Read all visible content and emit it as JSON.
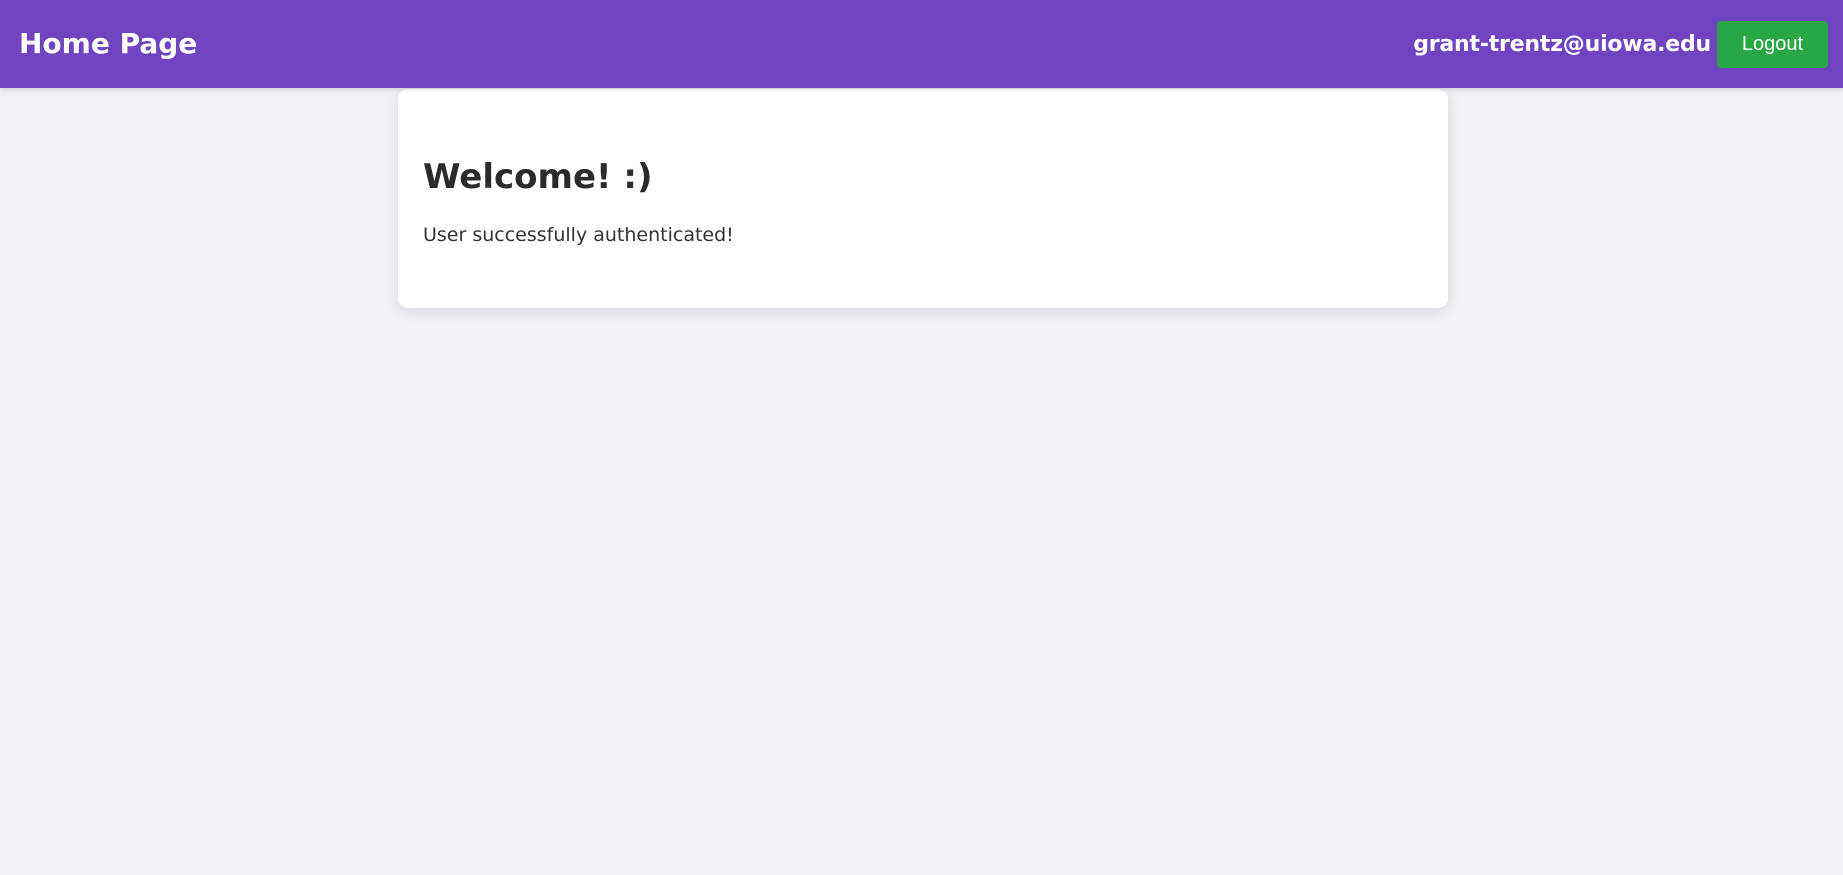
{
  "header": {
    "title": "Home Page",
    "user_email": "grant-trentz@uiowa.edu",
    "logout_label": "Logout"
  },
  "main": {
    "heading": "Welcome! :)",
    "message": "User successfully authenticated!"
  },
  "colors": {
    "header_background": "#7044c1",
    "logout_button": "#28a745",
    "page_background": "#eff2f6",
    "card_background": "#ffffff"
  }
}
